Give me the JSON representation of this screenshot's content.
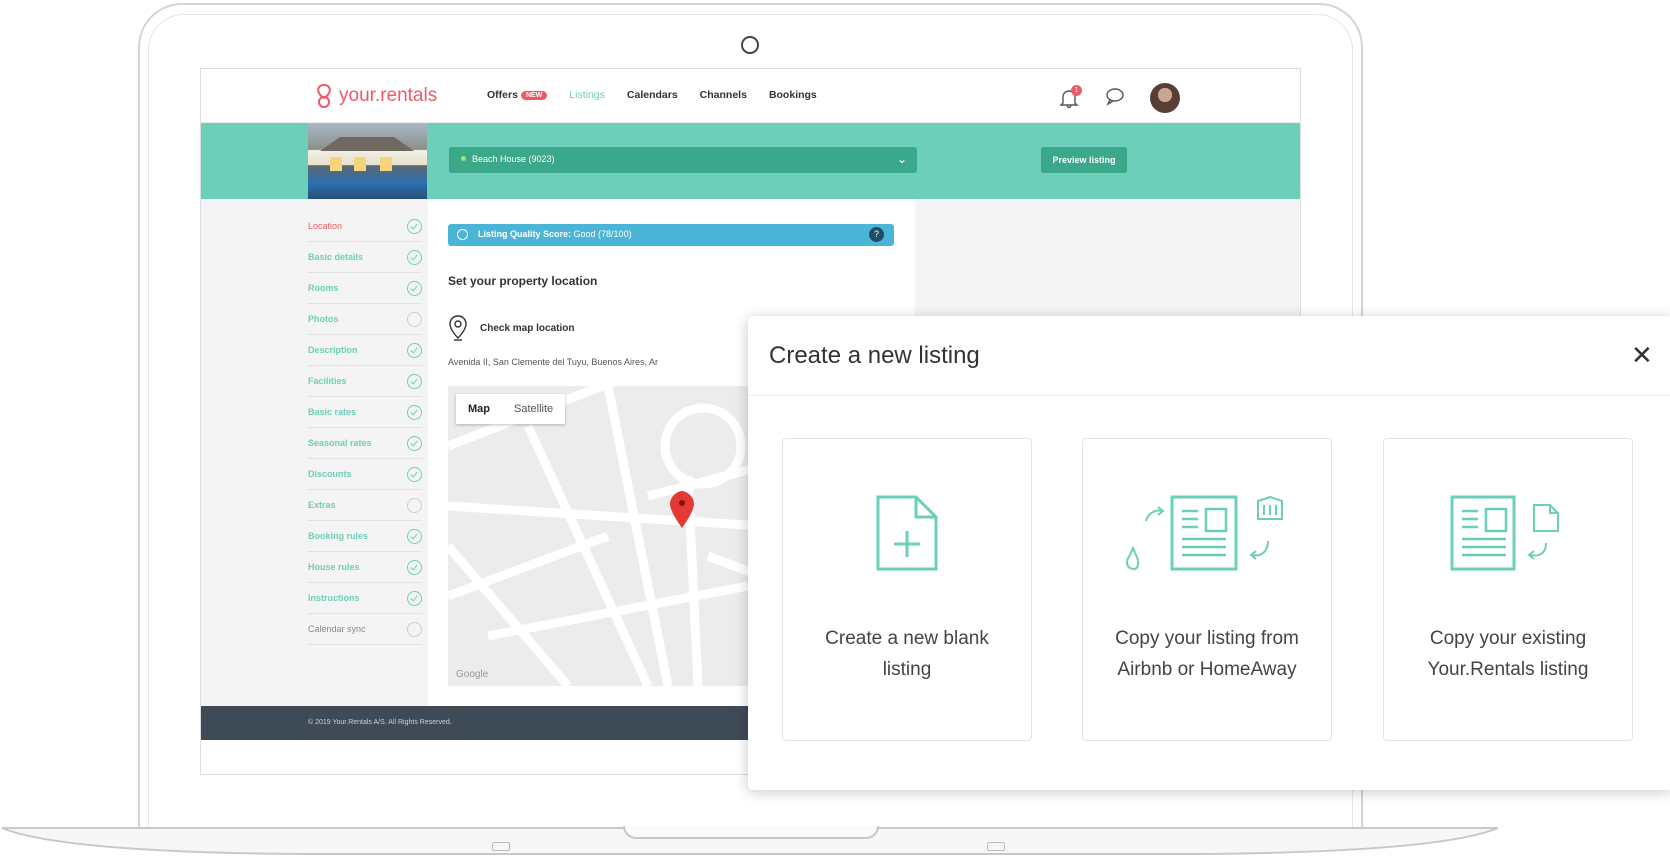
{
  "app": {
    "logo_text": "your.rentals",
    "nav": {
      "offers": "Offers",
      "offers_badge": "NEW",
      "listings": "Listings",
      "calendars": "Calendars",
      "channels": "Channels",
      "bookings": "Bookings"
    },
    "notification_count": "1"
  },
  "hero": {
    "property_select": "Beach House (9023)",
    "preview_label": "Preview listing"
  },
  "sidebar": {
    "items": [
      {
        "label": "Location"
      },
      {
        "label": "Basic details"
      },
      {
        "label": "Rooms"
      },
      {
        "label": "Photos"
      },
      {
        "label": "Description"
      },
      {
        "label": "Facilities"
      },
      {
        "label": "Basic rates"
      },
      {
        "label": "Seasonal rates"
      },
      {
        "label": "Discounts"
      },
      {
        "label": "Extras"
      },
      {
        "label": "Booking rules"
      },
      {
        "label": "House rules"
      },
      {
        "label": "Instructions"
      },
      {
        "label": "Calendar sync"
      }
    ]
  },
  "main": {
    "quality_label": "Listing Quality Score:",
    "quality_value": "Good (78/100)",
    "quality_help": "?",
    "section_title": "Set your property location",
    "check_map_label": "Check map location",
    "address": "Avenida II, San Clemente del Tuyu, Buenos Aires, Ar",
    "map_toggle": {
      "map": "Map",
      "satellite": "Satellite"
    },
    "map_watermark": "Google"
  },
  "footer": {
    "copyright": "© 2019 Your.Rentals A/S. All Rights Reserved."
  },
  "modal": {
    "title": "Create a new listing",
    "close": "✕",
    "cards": [
      {
        "label": "Create a new blank listing",
        "icon": "new-document-icon"
      },
      {
        "label": "Copy your listing from Airbnb or HomeAway",
        "icon": "import-listing-icon"
      },
      {
        "label": "Copy your existing Your.Rentals listing",
        "icon": "copy-listing-icon"
      }
    ]
  },
  "colors": {
    "accent": "#6ccfb9",
    "brand": "#f05a67",
    "button": "#3aa889",
    "info": "#4bb5d8",
    "footer": "#3e4a56"
  }
}
